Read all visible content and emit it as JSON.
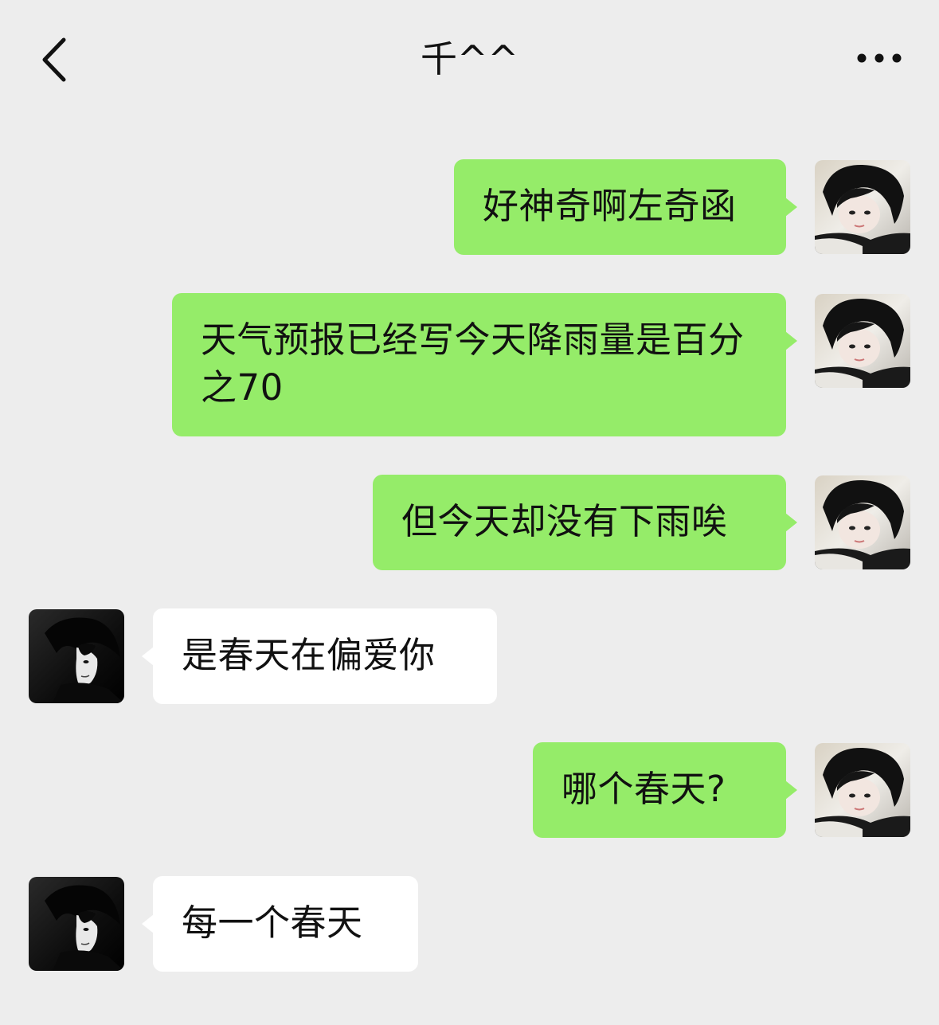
{
  "header": {
    "title": "千^^",
    "back_icon": "chevron-left-icon",
    "more_icon": "more-dots-icon"
  },
  "colors": {
    "background": "#ededed",
    "sent_bubble": "#95ec69",
    "received_bubble": "#ffffff"
  },
  "messages": [
    {
      "sender": "me",
      "text": "好神奇啊左奇函"
    },
    {
      "sender": "me",
      "text": "天气预报已经写今天降雨量是百分之70"
    },
    {
      "sender": "me",
      "text": "但今天却没有下雨唉"
    },
    {
      "sender": "them",
      "text": "是春天在偏爱你"
    },
    {
      "sender": "me",
      "text": "哪个春天?"
    },
    {
      "sender": "them",
      "text": "每一个春天"
    }
  ]
}
